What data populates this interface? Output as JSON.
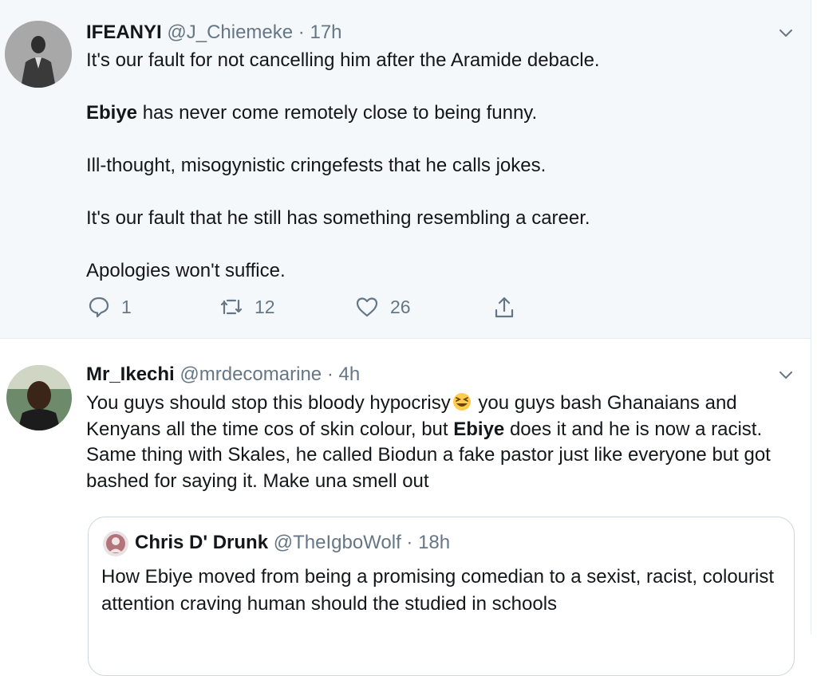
{
  "tweets": [
    {
      "name": "IFEANYI",
      "handle": "@J_Chiemeke",
      "separator": "·",
      "time": "17h",
      "paragraphs": [
        {
          "pre": "It's our fault for not cancelling him after the Aramide debacle.",
          "bold": "",
          "post": ""
        },
        {
          "pre": "",
          "bold": "Ebiye",
          "post": " has never come remotely close to being funny."
        },
        {
          "pre": "Ill-thought, misogynistic cringefests that he calls jokes.",
          "bold": "",
          "post": ""
        },
        {
          "pre": "It's our fault that he still has something resembling a career.",
          "bold": "",
          "post": ""
        },
        {
          "pre": "Apologies won't suffice.",
          "bold": "",
          "post": ""
        }
      ],
      "actions": {
        "reply_count": "1",
        "retweet_count": "12",
        "like_count": "26"
      }
    },
    {
      "name": "Mr_Ikechi",
      "handle": "@mrdecomarine",
      "separator": "·",
      "time": "4h",
      "text_1": "You guys should stop this bloody hypocrisy",
      "emoji": "grinning-squinting-face",
      "text_2": " you guys bash Ghanaians and Kenyans all the time cos of skin colour, but ",
      "bold": "Ebiye",
      "text_3": " does it and he is now a racist. Same thing with Skales, he called  Biodun a fake pastor just like everyone but got bashed for saying it. Make una smell out",
      "quote": {
        "name": "Chris D' Drunk",
        "handle": "@TheIgboWolf",
        "separator": "·",
        "time": "18h",
        "text": "How Ebiye moved from being a promising comedian to a sexist, racist, colourist attention craving human should the studied in schools"
      }
    }
  ],
  "icons": {
    "reply": "speech-bubble-icon",
    "retweet": "retweet-arrows-icon",
    "like": "heart-icon",
    "share": "share-upload-icon",
    "caret": "chevron-down-icon"
  },
  "colors": {
    "text": "#14171a",
    "secondary": "#657786",
    "highlight_bg": "#f5f8fa",
    "border": "#ccd6dd"
  }
}
